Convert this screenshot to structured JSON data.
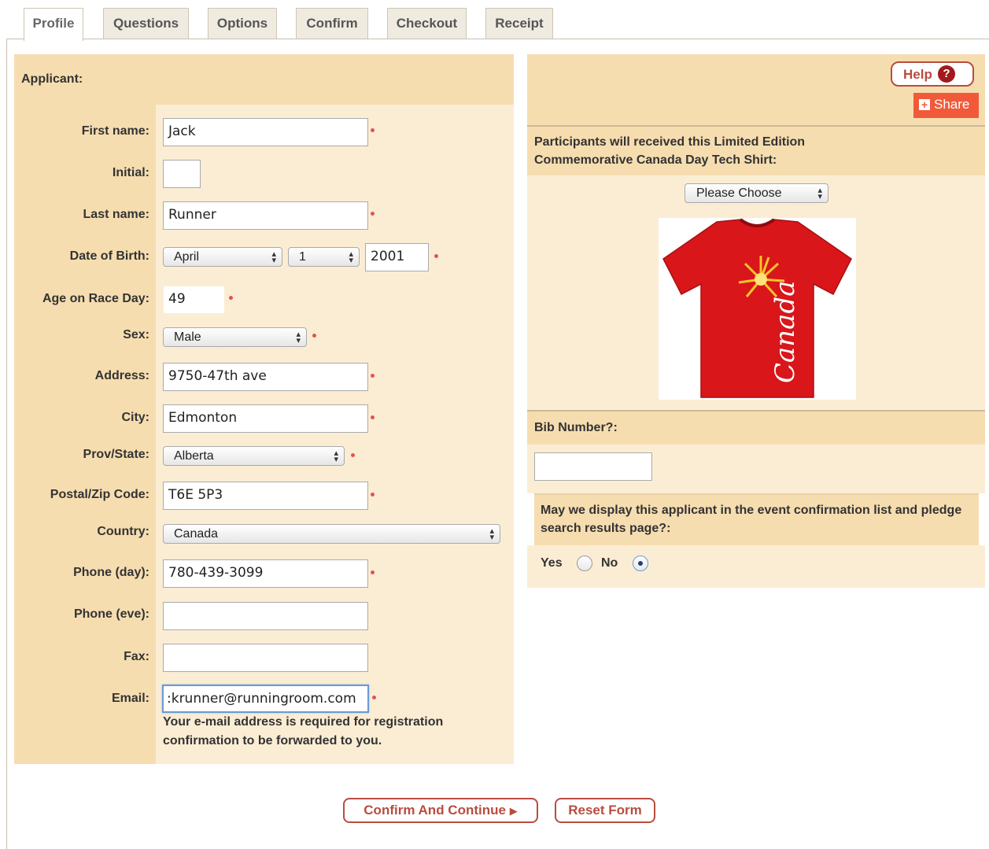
{
  "tabs": [
    "Profile",
    "Questions",
    "Options",
    "Confirm",
    "Checkout",
    "Receipt"
  ],
  "applicant": {
    "section_title": "Applicant:",
    "labels": {
      "first_name": "First name:",
      "initial": "Initial:",
      "last_name": "Last name:",
      "dob": "Date of Birth:",
      "age": "Age on Race Day:",
      "sex": "Sex:",
      "address": "Address:",
      "city": "City:",
      "prov": "Prov/State:",
      "postal": "Postal/Zip Code:",
      "country": "Country:",
      "phone_day": "Phone (day):",
      "phone_eve": "Phone (eve):",
      "fax": "Fax:",
      "email": "Email:"
    },
    "values": {
      "first_name": "Jack",
      "initial": "",
      "last_name": "Runner",
      "dob_month": "April",
      "dob_day": "1",
      "dob_year": "2001",
      "age": "49",
      "sex": "Male",
      "address": "9750-47th ave",
      "city": "Edmonton",
      "prov": "Alberta",
      "postal": "T6E 5P3",
      "country": "Canada",
      "phone_day": "780-439-3099",
      "phone_eve": "",
      "fax": "",
      "email": ":krunner@runningroom.com"
    },
    "email_hint": "Your e-mail address is required for registration confirmation to be forwarded to you."
  },
  "right": {
    "help_label": "Help",
    "help_icon": "question-mark",
    "share_label": "Share",
    "shirt_text": "Participants will received this Limited Edition Commemorative Canada Day Tech Shirt:",
    "shirt_select": "Please Choose",
    "shirt_image_text": "Canada",
    "bib_label": "Bib Number?:",
    "bib_value": "",
    "display_question": "May we display this applicant in the event confirmation list and pledge search results page?:",
    "yes_label": "Yes",
    "no_label": "No",
    "display_choice": "No"
  },
  "buttons": {
    "confirm": "Confirm And Continue",
    "reset": "Reset Form"
  },
  "colors": {
    "label_bg": "#f6ddb0",
    "field_bg": "#fbedd4",
    "accent": "#b94c3e",
    "share": "#f05a3a",
    "shirt": "#d9161a"
  }
}
